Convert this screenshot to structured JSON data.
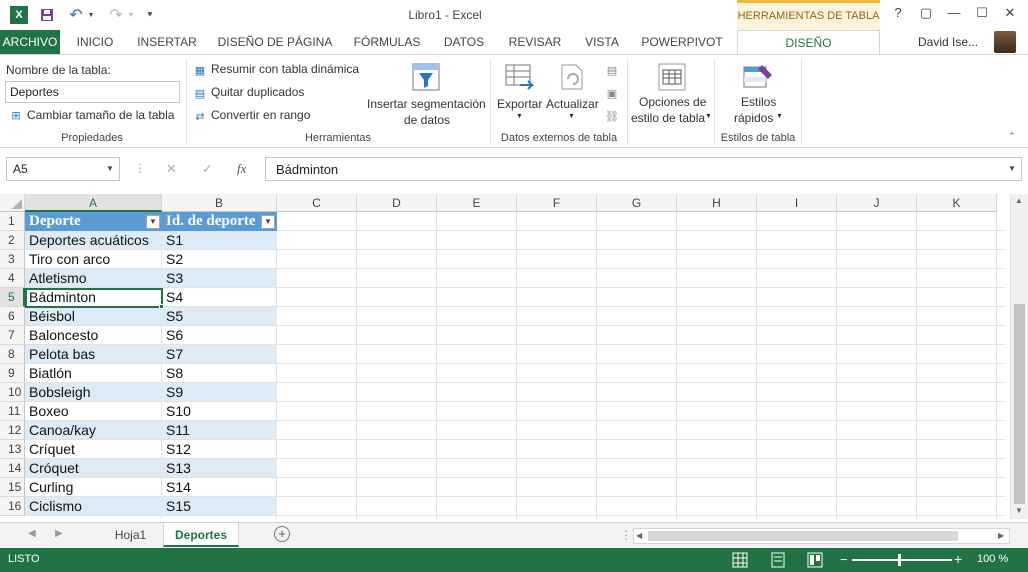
{
  "app": {
    "title": "Libro1 - Excel",
    "contextual_tab": "HERRAMIENTAS DE TABLA",
    "user": "David Ise...",
    "win_buttons": [
      "?",
      "▢",
      "—",
      "☐",
      "✕"
    ]
  },
  "tabs": [
    "ARCHIVO",
    "INICIO",
    "INSERTAR",
    "DISEÑO DE PÁGINA",
    "FÓRMULAS",
    "DATOS",
    "REVISAR",
    "VISTA",
    "POWERPIVOT",
    "DISEÑO"
  ],
  "ribbon": {
    "propiedades": {
      "table_name_label": "Nombre de la tabla:",
      "table_name_value": "Deportes",
      "resize": "Cambiar tamaño de la tabla",
      "group_label": "Propiedades"
    },
    "herramientas": {
      "pivot": "Resumir con tabla dinámica",
      "duplicates": "Quitar duplicados",
      "convert": "Convertir en rango",
      "slicer_line1": "Insertar segmentación",
      "slicer_line2": "de datos",
      "group_label": "Herramientas"
    },
    "datos_externos": {
      "export": "Exportar",
      "refresh": "Actualizar",
      "group_label": "Datos externos de tabla"
    },
    "opciones": {
      "line1": "Opciones de",
      "line2": "estilo de tabla"
    },
    "estilos": {
      "line1": "Estilos",
      "line2": "rápidos",
      "group_label": "Estilos de tabla"
    }
  },
  "formula_bar": {
    "name_box": "A5",
    "cancel": "✕",
    "enter": "✓",
    "fx": "fx",
    "value": "Bádminton"
  },
  "columns": [
    "A",
    "B",
    "C",
    "D",
    "E",
    "F",
    "G",
    "H",
    "I",
    "J",
    "K"
  ],
  "table_headers": [
    "Deporte",
    "Id. de deporte"
  ],
  "rows": [
    {
      "n": "1"
    },
    {
      "n": "2",
      "a": "Deportes acuáticos",
      "b": "S1"
    },
    {
      "n": "3",
      "a": "Tiro con arco",
      "b": "S2"
    },
    {
      "n": "4",
      "a": "Atletismo",
      "b": "S3"
    },
    {
      "n": "5",
      "a": "Bádminton",
      "b": "S4"
    },
    {
      "n": "6",
      "a": "Béisbol",
      "b": "S5"
    },
    {
      "n": "7",
      "a": "Baloncesto",
      "b": "S6"
    },
    {
      "n": "8",
      "a": "Pelota bas",
      "b": "S7"
    },
    {
      "n": "9",
      "a": "Biatlón",
      "b": "S8"
    },
    {
      "n": "10",
      "a": "Bobsleigh",
      "b": "S9"
    },
    {
      "n": "11",
      "a": "Boxeo",
      "b": "S10"
    },
    {
      "n": "12",
      "a": "Canoa/kay",
      "b": "S11"
    },
    {
      "n": "13",
      "a": "Críquet",
      "b": "S12"
    },
    {
      "n": "14",
      "a": "Cróquet",
      "b": "S13"
    },
    {
      "n": "15",
      "a": "Curling",
      "b": "S14"
    },
    {
      "n": "16",
      "a": "Ciclismo",
      "b": "S15"
    }
  ],
  "sheets": [
    "Hoja1",
    "Deportes"
  ],
  "status": {
    "text": "LISTO",
    "zoom": "100 %"
  },
  "colors": {
    "accent": "#217346",
    "table_header": "#5b9bd5",
    "band": "#ddebf7"
  }
}
